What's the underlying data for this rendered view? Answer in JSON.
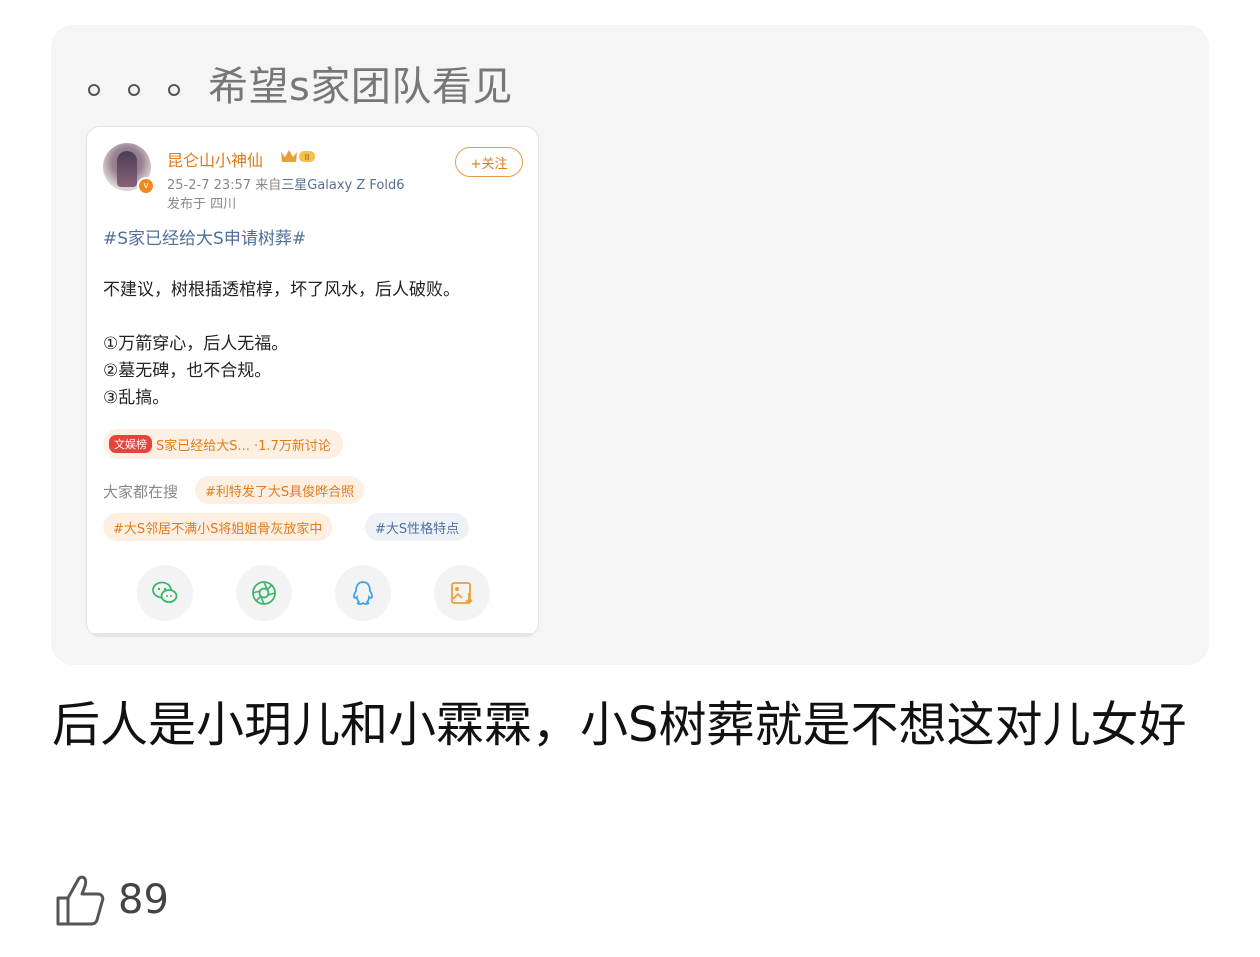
{
  "quote": {
    "text": "希望s家团队看见"
  },
  "card": {
    "username": "昆仑山小神仙",
    "level_badge": "II",
    "timestamp": "25-2-7 23:57",
    "source_prefix": "来自",
    "device": "三星Galaxy Z Fold6",
    "location": "发布于 四川",
    "follow_label": "+关注",
    "hashtag": "#S家已经给大S申请树葬#",
    "body_line1": "不建议，树根插透棺椁，坏了风水，后人破败。",
    "body_line2": "①万箭穿心，后人无福。",
    "body_line3": "②墓无碑，也不合规。",
    "body_line4": "③乱搞。",
    "hot_tag": "文娱榜",
    "hot_text": "S家已经给大S... ·1.7万新讨论",
    "searching_label": "大家都在搜",
    "search_tags": [
      "#利特发了大S具俊晔合照",
      "#大S邻居不满小S将姐姐骨灰放家中",
      "#大S性格特点"
    ],
    "share_icons": [
      "wechat-icon",
      "moments-icon",
      "qq-icon",
      "save-image-icon"
    ]
  },
  "comment": {
    "text": "后人是小玥儿和小霖霖，小S树葬就是不想这对儿女好"
  },
  "like": {
    "count": "89"
  },
  "colors": {
    "accent_orange": "#e07b1a",
    "link_blue": "#4f6f9d",
    "hot_red": "#e8433b"
  }
}
